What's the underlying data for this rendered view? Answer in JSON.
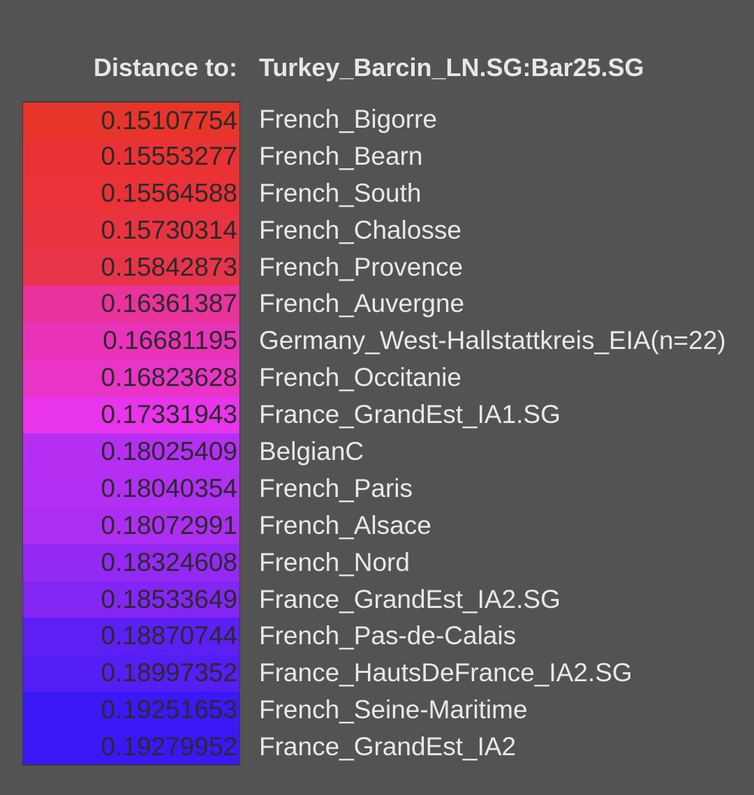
{
  "header": {
    "label": "Distance to:",
    "target": "Turkey_Barcin_LN.SG:Bar25.SG"
  },
  "rows": [
    {
      "distance": "0.15107754",
      "name": "French_Bigorre",
      "color": "#e8352a"
    },
    {
      "distance": "0.15553277",
      "name": "French_Bearn",
      "color": "#ea3235"
    },
    {
      "distance": "0.15564588",
      "name": "French_South",
      "color": "#ea3238"
    },
    {
      "distance": "0.15730314",
      "name": "French_Chalosse",
      "color": "#e93340"
    },
    {
      "distance": "0.15842873",
      "name": "French_Provence",
      "color": "#e83448"
    },
    {
      "distance": "0.16361387",
      "name": "French_Auvergne",
      "color": "#e9329b"
    },
    {
      "distance": "0.16681195",
      "name": "Germany_West-Hallstattkreis_EIA(n=22)",
      "color": "#e833b8"
    },
    {
      "distance": "0.16823628",
      "name": "French_Occitanie",
      "color": "#e934c6"
    },
    {
      "distance": "0.17331943",
      "name": "France_GrandEst_IA1.SG",
      "color": "#e834ea"
    },
    {
      "distance": "0.18025409",
      "name": "BelgianC",
      "color": "#b52ff3"
    },
    {
      "distance": "0.18040354",
      "name": "French_Paris",
      "color": "#b22ff3"
    },
    {
      "distance": "0.18072991",
      "name": "French_Alsace",
      "color": "#ad2ef3"
    },
    {
      "distance": "0.18324608",
      "name": "French_Nord",
      "color": "#9429f3"
    },
    {
      "distance": "0.18533649",
      "name": "France_GrandEst_IA2.SG",
      "color": "#8326f3"
    },
    {
      "distance": "0.18870744",
      "name": "French_Pas-de-Calais",
      "color": "#5c1ff4"
    },
    {
      "distance": "0.18997352",
      "name": "France_HautsDeFrance_IA2.SG",
      "color": "#551ef4"
    },
    {
      "distance": "0.19251653",
      "name": "French_Seine-Maritime",
      "color": "#3b18f5"
    },
    {
      "distance": "0.19279952",
      "name": "France_GrandEst_IA2",
      "color": "#3a18f5"
    }
  ]
}
